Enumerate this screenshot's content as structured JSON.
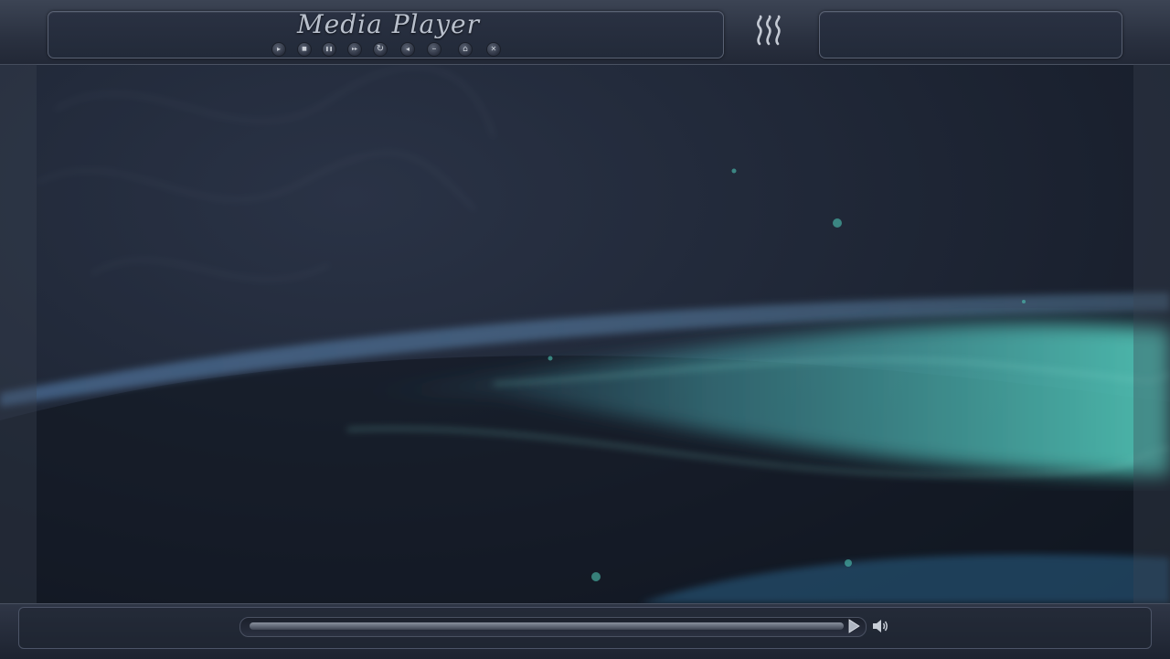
{
  "app": {
    "title": "Media Player"
  },
  "toolbar": {
    "buttons": [
      {
        "icon": "play-icon",
        "glyph": "▸"
      },
      {
        "icon": "stop-icon",
        "glyph": "■"
      },
      {
        "icon": "pause-icon",
        "glyph": "❚❚"
      },
      {
        "icon": "fast-forward-icon",
        "glyph": "▸▸"
      },
      {
        "icon": "refresh-icon",
        "glyph": "↻"
      },
      {
        "icon": "rewind-icon",
        "glyph": "◂"
      },
      {
        "icon": "minus-icon",
        "glyph": "–"
      },
      {
        "icon": "home-icon",
        "glyph": "⌂"
      },
      {
        "icon": "close-icon",
        "glyph": "✕"
      }
    ]
  },
  "playback": {
    "progress": 0.0
  },
  "colors": {
    "background": "#1a2233",
    "accent": "#3fb3a8",
    "title_text": "#b9c0cc"
  }
}
